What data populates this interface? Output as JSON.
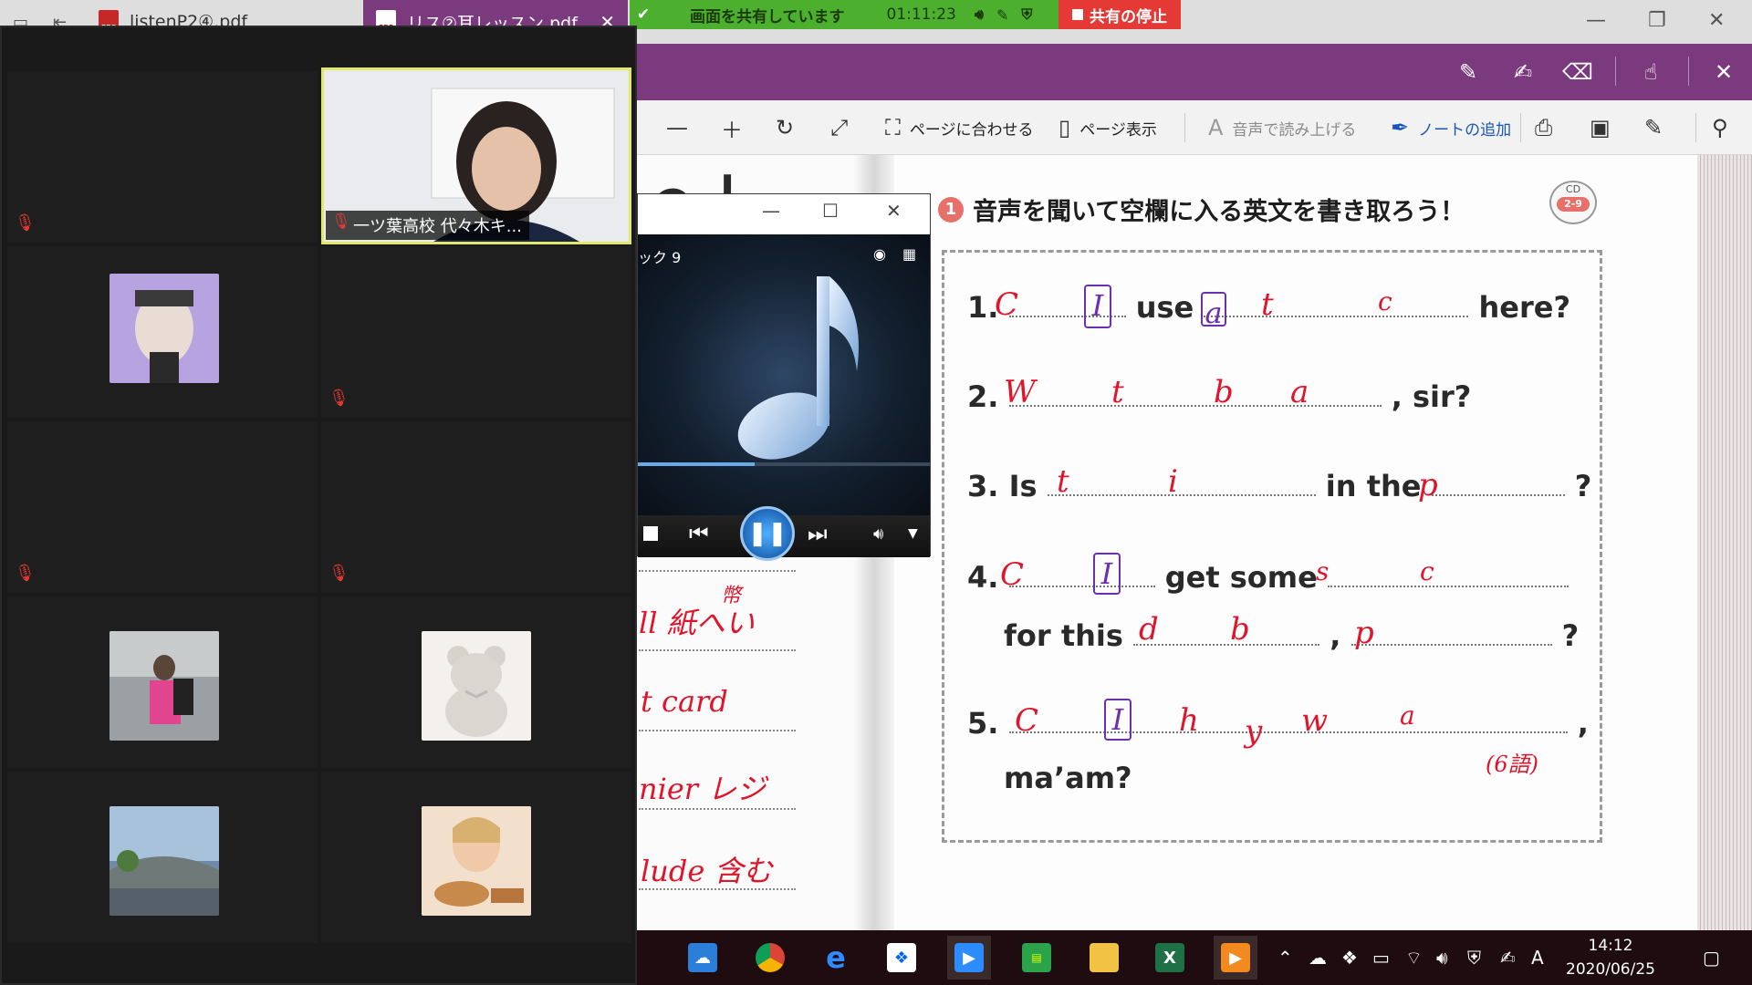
{
  "browser": {
    "tabs": [
      {
        "label": "listenP2④.pdf",
        "active": false
      },
      {
        "label": "リス②耳レッスン.pdf",
        "active": true
      }
    ],
    "pdf_badge": "PDF"
  },
  "share_bar": {
    "status": "画面を共有しています",
    "elapsed": "01:11:23",
    "stop_label": "共有の停止",
    "colors": {
      "bar": "#4caf2e",
      "stop": "#e53935"
    }
  },
  "toolbar": {
    "fit_page": "ページに合わせる",
    "page_view": "ページ表示",
    "read_aloud": "音声で読み上げる",
    "add_note": "ノートの追加"
  },
  "document": {
    "exercise_number": "1",
    "exercise_title": "音声を聞いて空欄に入る英文を書き取ろう！",
    "cd_label": "CD",
    "cd_track": "2-9",
    "items": [
      {
        "number": "1.",
        "prefix": "",
        "middle": "use",
        "suffix": "here?"
      },
      {
        "number": "2.",
        "suffix": ", sir?"
      },
      {
        "number": "3.",
        "prefix": "Is",
        "middle": "in the",
        "suffix": "?"
      },
      {
        "number": "4.",
        "middle": "get some",
        "line2_prefix": "for this",
        "line2_suffix": "?"
      },
      {
        "number": "5.",
        "suffix": ",",
        "line2": "ma’am?"
      }
    ],
    "handwriting": {
      "q1": [
        "C",
        "I",
        "a",
        "t",
        "c"
      ],
      "q2": [
        "W",
        "t",
        "b",
        "a"
      ],
      "q3": [
        "t",
        "i",
        "p"
      ],
      "q4": [
        "C",
        "I",
        "s",
        "c",
        "d",
        "b",
        "p"
      ],
      "q5": [
        "C",
        "I",
        "h",
        "y",
        "w",
        "a"
      ],
      "q5_note": "(6語)",
      "left_notes": [
        "ll 紙へい",
        "幣",
        "t card",
        "nier レジ",
        "lude 含む"
      ]
    }
  },
  "zoom": {
    "speaker_name": "一ツ葉高校 代々木キ..."
  },
  "player": {
    "track_label": "ック 9"
  },
  "taskbar": {
    "time": "14:12",
    "date": "2020/06/25",
    "ime": "A"
  }
}
